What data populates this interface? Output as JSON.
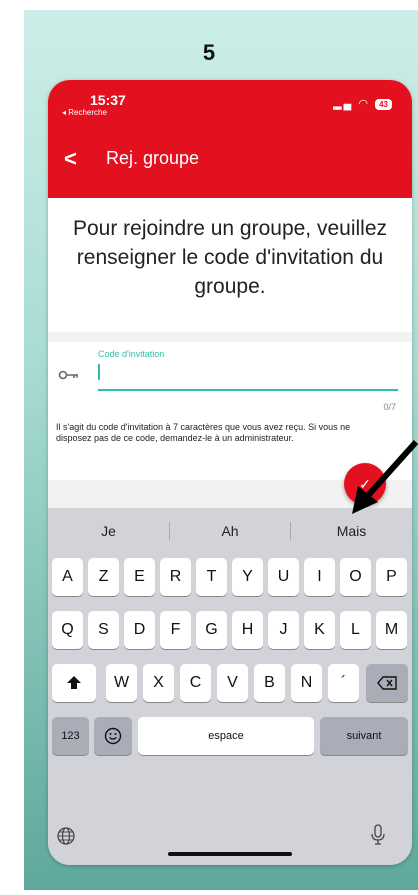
{
  "step_label": "5",
  "status_bar": {
    "time": "15:37",
    "back_app": "◂ Recherche",
    "battery": "43",
    "signal_icons": "signal-wifi"
  },
  "nav": {
    "back_icon": "chevron-left-icon",
    "title": "Rej. groupe"
  },
  "intro": "Pour rejoindre un groupe, veuillez renseigner le code d'invitation du groupe.",
  "form": {
    "field_icon": "key-icon",
    "field_label": "Code d'invitation",
    "value": "",
    "counter": "0/7",
    "help_text": "Il s'agit du code d'invitation à 7 caractères que vous avez reçu. Si vous ne disposez pas de ce code, demandez-le à un administrateur."
  },
  "confirm_button": {
    "icon": "checkmark-icon",
    "glyph": "✓"
  },
  "keyboard": {
    "suggestions": [
      "Je",
      "Ah",
      "Mais"
    ],
    "row1": [
      "A",
      "Z",
      "E",
      "R",
      "T",
      "Y",
      "U",
      "I",
      "O",
      "P"
    ],
    "row2": [
      "Q",
      "S",
      "D",
      "F",
      "G",
      "H",
      "J",
      "K",
      "L",
      "M"
    ],
    "row3": [
      "W",
      "X",
      "C",
      "V",
      "B",
      "N",
      "´"
    ],
    "numbers_key": "123",
    "space_key": "espace",
    "next_key": "suivant"
  },
  "colors": {
    "primary": "#e3101f",
    "accent": "#2cbfa4",
    "keyboard_bg": "#d1d3d9"
  }
}
